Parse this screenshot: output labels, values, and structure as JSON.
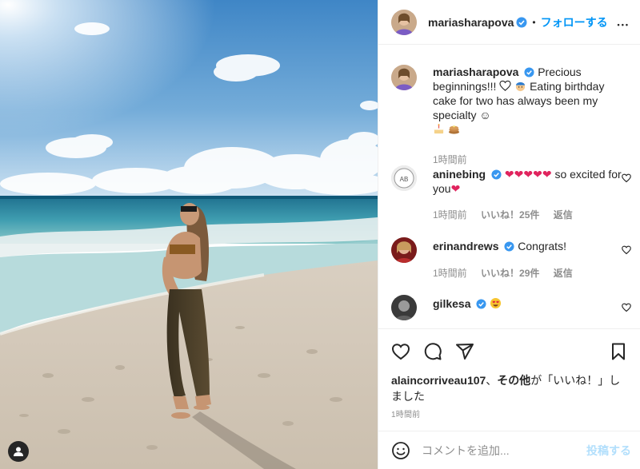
{
  "post": {
    "author": "mariasharapova",
    "dot": "•",
    "follow_label": "フォローする",
    "more_label": "•••",
    "caption_prefix": "Precious beginnings!!!",
    "caption_mid": "Eating birthday cake for two has always been my specialty",
    "caption_time": "1時間前",
    "colors": {
      "accent": "#0095f6",
      "verified": "#3897f0",
      "heart": "#ed4956",
      "muted": "#8e8e8e"
    }
  },
  "comments": [
    {
      "user": "aninebing",
      "text_tail": "so excited for you",
      "time": "1時間前",
      "likes": "いいね！25件",
      "reply": "返信"
    },
    {
      "user": "erinandrews",
      "text": "Congrats!",
      "time": "1時間前",
      "likes": "いいね！29件",
      "reply": "返信"
    },
    {
      "user": "gilkesa",
      "time": "",
      "likes": "",
      "reply": ""
    }
  ],
  "likes_line": {
    "user": "alaincorriveau107",
    "sep": "、",
    "others": "その他",
    "tail": "が「いいね！」しました"
  },
  "post_time": "1時間前",
  "comment_box": {
    "placeholder": "コメントを追加...",
    "post_label": "投稿する"
  },
  "icons": [
    "heart-icon",
    "comment-icon",
    "share-icon",
    "bookmark-icon",
    "emoji-icon",
    "user-tag-icon",
    "more-icon",
    "verified-badge-icon"
  ]
}
